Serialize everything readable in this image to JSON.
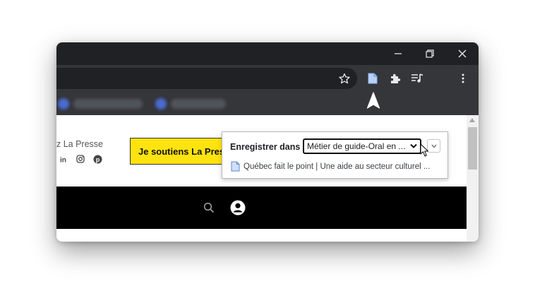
{
  "window_controls": {
    "minimize": "minimize-icon",
    "restore": "restore-icon",
    "close": "close-icon"
  },
  "toolbar": {
    "icons": [
      "star-icon",
      "page-icon",
      "extensions-icon",
      "reading-list-icon",
      "more-icon"
    ]
  },
  "page": {
    "header_text": "z La Presse",
    "social_icons": [
      "linkedin-icon",
      "instagram-icon",
      "pinterest-icon"
    ],
    "support_button": "Je soutiens La Presse",
    "nav_icons": [
      "search-icon",
      "account-icon"
    ]
  },
  "popup": {
    "label": "Enregistrer dans",
    "selected_folder": "Métier de guide-Oral en ...",
    "page_title": "Québec fait le point | Une aide au secteur culturel ..."
  },
  "colors": {
    "support_button": "#ffe30f",
    "titlebar": "#202124",
    "toolbar": "#35363a"
  }
}
